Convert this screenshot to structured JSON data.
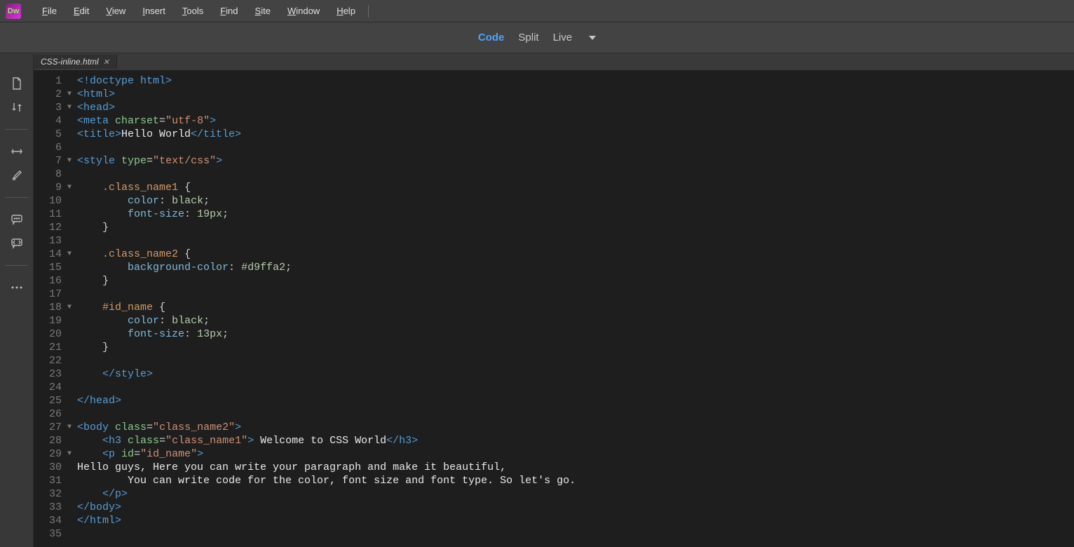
{
  "menubar": {
    "items": [
      {
        "label": "File",
        "u": "F"
      },
      {
        "label": "Edit",
        "u": "E"
      },
      {
        "label": "View",
        "u": "V"
      },
      {
        "label": "Insert",
        "u": "I"
      },
      {
        "label": "Tools",
        "u": "T"
      },
      {
        "label": "Find",
        "u": "F"
      },
      {
        "label": "Site",
        "u": "S"
      },
      {
        "label": "Window",
        "u": "W"
      },
      {
        "label": "Help",
        "u": "H"
      }
    ],
    "logo_text": "Dw"
  },
  "view_tabs": {
    "code": "Code",
    "split": "Split",
    "live": "Live"
  },
  "file_tab": "CSS-inline.html",
  "sidebar_icons": [
    "document-icon",
    "sort-icon",
    "expand-icon",
    "brush-icon",
    "chat-icon",
    "snippet-icon",
    "more-icon"
  ],
  "code_lines": [
    {
      "n": 1,
      "f": "",
      "html": "<span class='tag'>&lt;!doctype html&gt;</span>"
    },
    {
      "n": 2,
      "f": "▼",
      "html": "<span class='tag'>&lt;html&gt;</span>"
    },
    {
      "n": 3,
      "f": "▼",
      "html": "<span class='tag'>&lt;head&gt;</span>"
    },
    {
      "n": 4,
      "f": "",
      "html": "<span class='tag'>&lt;meta</span> <span class='attr-name'>charset</span><span class='punc'>=</span><span class='attr-val'>\"utf-8\"</span><span class='tag'>&gt;</span>"
    },
    {
      "n": 5,
      "f": "",
      "html": "<span class='tag'>&lt;title&gt;</span><span class='plain'>Hello World</span><span class='tag'>&lt;/title&gt;</span>"
    },
    {
      "n": 6,
      "f": "",
      "html": ""
    },
    {
      "n": 7,
      "f": "▼",
      "html": "<span class='tag'>&lt;style</span> <span class='attr-name'>type</span><span class='punc'>=</span><span class='attr-val'>\"text/css\"</span><span class='tag'>&gt;</span>"
    },
    {
      "n": 8,
      "f": "",
      "html": ""
    },
    {
      "n": 9,
      "f": "▼",
      "html": "    <span class='sel'>.class_name1</span> <span class='punc'>{</span>"
    },
    {
      "n": 10,
      "f": "",
      "html": "        <span class='prop'>color</span><span class='punc'>:</span> <span class='val'>black</span><span class='punc'>;</span>"
    },
    {
      "n": 11,
      "f": "",
      "html": "        <span class='prop'>font-size</span><span class='punc'>:</span> <span class='val'>19px</span><span class='punc'>;</span>"
    },
    {
      "n": 12,
      "f": "",
      "html": "    <span class='punc'>}</span>"
    },
    {
      "n": 13,
      "f": "",
      "html": ""
    },
    {
      "n": 14,
      "f": "▼",
      "html": "    <span class='sel'>.class_name2</span> <span class='punc'>{</span>"
    },
    {
      "n": 15,
      "f": "",
      "html": "        <span class='prop'>background-color</span><span class='punc'>:</span> <span class='val'>#d9ffa2</span><span class='punc'>;</span>"
    },
    {
      "n": 16,
      "f": "",
      "html": "    <span class='punc'>}</span>"
    },
    {
      "n": 17,
      "f": "",
      "html": ""
    },
    {
      "n": 18,
      "f": "▼",
      "html": "    <span class='sel'>#id_name</span> <span class='punc'>{</span>"
    },
    {
      "n": 19,
      "f": "",
      "html": "        <span class='prop'>color</span><span class='punc'>:</span> <span class='val'>black</span><span class='punc'>;</span>"
    },
    {
      "n": 20,
      "f": "",
      "html": "        <span class='prop'>font-size</span><span class='punc'>:</span> <span class='val'>13px</span><span class='punc'>;</span>"
    },
    {
      "n": 21,
      "f": "",
      "html": "    <span class='punc'>}</span>"
    },
    {
      "n": 22,
      "f": "",
      "html": ""
    },
    {
      "n": 23,
      "f": "",
      "html": "    <span class='tag'>&lt;/style&gt;</span>"
    },
    {
      "n": 24,
      "f": "",
      "html": ""
    },
    {
      "n": 25,
      "f": "",
      "html": "<span class='tag'>&lt;/head&gt;</span>"
    },
    {
      "n": 26,
      "f": "",
      "html": ""
    },
    {
      "n": 27,
      "f": "▼",
      "html": "<span class='tag'>&lt;body</span> <span class='attr-name'>class</span><span class='punc'>=</span><span class='attr-val'>\"class_name2\"</span><span class='tag'>&gt;</span>"
    },
    {
      "n": 28,
      "f": "",
      "html": "    <span class='tag'>&lt;h3</span> <span class='attr-name'>class</span><span class='punc'>=</span><span class='attr-val'>\"class_name1\"</span><span class='tag'>&gt;</span><span class='plain'> Welcome to CSS World</span><span class='tag'>&lt;/h3&gt;</span>"
    },
    {
      "n": 29,
      "f": "▼",
      "html": "    <span class='tag'>&lt;p</span> <span class='attr-name'>id</span><span class='punc'>=</span><span class='attr-val'>\"id_name\"</span><span class='tag'>&gt;</span>"
    },
    {
      "n": 30,
      "f": "",
      "html": "<span class='plain'>Hello guys, Here you can write your paragraph and make it beautiful,</span>"
    },
    {
      "n": 31,
      "f": "",
      "html": "<span class='plain'>        You can write code for the color, font size and font type. So let's go.</span>"
    },
    {
      "n": 32,
      "f": "",
      "html": "    <span class='tag'>&lt;/p&gt;</span>"
    },
    {
      "n": 33,
      "f": "",
      "html": "<span class='tag'>&lt;/body&gt;</span>"
    },
    {
      "n": 34,
      "f": "",
      "html": "<span class='tag'>&lt;/html&gt;</span>"
    },
    {
      "n": 35,
      "f": "",
      "html": ""
    }
  ]
}
